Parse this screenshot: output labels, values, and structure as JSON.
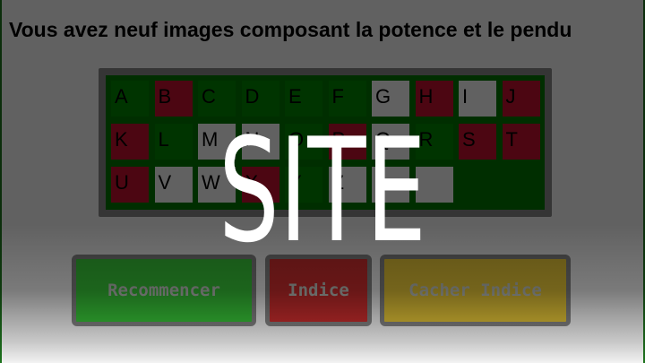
{
  "instruction": "Vous avez neuf images composant la potence et le pendu",
  "keyboard": {
    "rows": [
      [
        {
          "letter": "A",
          "state": "unused"
        },
        {
          "letter": "B",
          "state": "wrong"
        },
        {
          "letter": "C",
          "state": "unused"
        },
        {
          "letter": "D",
          "state": "unused"
        },
        {
          "letter": "E",
          "state": "unused"
        },
        {
          "letter": "F",
          "state": "unused"
        },
        {
          "letter": "G",
          "state": "right"
        },
        {
          "letter": "H",
          "state": "wrong"
        },
        {
          "letter": "I",
          "state": "right"
        },
        {
          "letter": "J",
          "state": "wrong"
        }
      ],
      [
        {
          "letter": "K",
          "state": "wrong"
        },
        {
          "letter": "L",
          "state": "unused"
        },
        {
          "letter": "M",
          "state": "right"
        },
        {
          "letter": "N",
          "state": "right"
        },
        {
          "letter": "O",
          "state": "unused"
        },
        {
          "letter": "P",
          "state": "wrong"
        },
        {
          "letter": "Q",
          "state": "right"
        },
        {
          "letter": "R",
          "state": "unused"
        },
        {
          "letter": "S",
          "state": "wrong"
        },
        {
          "letter": "T",
          "state": "wrong"
        }
      ],
      [
        {
          "letter": "U",
          "state": "wrong"
        },
        {
          "letter": "V",
          "state": "right"
        },
        {
          "letter": "W",
          "state": "right"
        },
        {
          "letter": "X",
          "state": "wrong"
        },
        {
          "letter": "Y",
          "state": "unused"
        },
        {
          "letter": "Z",
          "state": "right"
        },
        {
          "letter": "-",
          "state": "right"
        },
        {
          "letter": "",
          "state": "right"
        }
      ]
    ]
  },
  "buttons": {
    "restart": "Recommencer",
    "hint": "Indice",
    "hide_hint": "Cacher Indice"
  },
  "watermark": "SITE"
}
